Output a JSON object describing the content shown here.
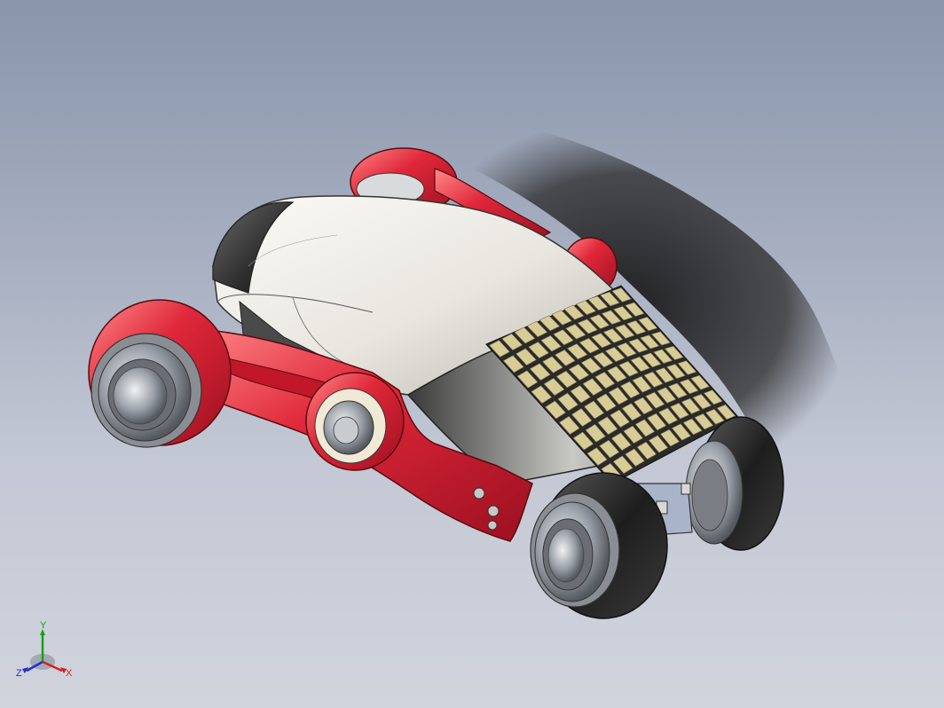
{
  "viewport": {
    "background_top": "#8a95aa",
    "background_bottom": "#d1d4dd"
  },
  "model": {
    "body_color": "#e8e6df",
    "nose_color": "#3a3a3a",
    "frame_color": "#e0283a",
    "panel_color": "#d8cc96",
    "tire_color": "#2a2a2a",
    "rim_color": "#b8bcc2"
  },
  "triad": {
    "x_label": "X",
    "y_label": "Y",
    "z_label": "Z",
    "x_color": "#d42020",
    "y_color": "#18a018",
    "z_color": "#2030c8"
  }
}
